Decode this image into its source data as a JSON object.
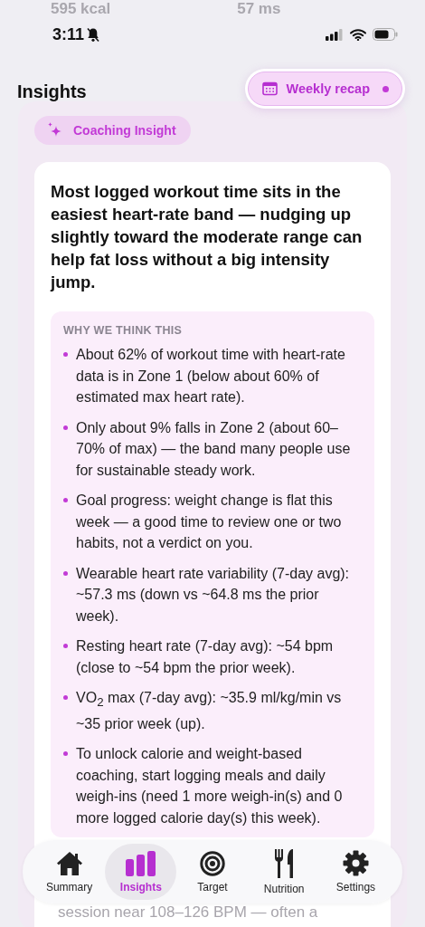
{
  "background_stats": [
    "595 kcal",
    "57 ms"
  ],
  "status_bar": {
    "time": "3:11",
    "silent": true
  },
  "header": {
    "title": "Insights",
    "recap_button": {
      "label": "Weekly recap",
      "unread": true
    }
  },
  "insight": {
    "badge": "Coaching Insight",
    "headline": "Most logged workout time sits in the easiest heart-rate band — nudging up slightly toward the moderate range can help fat loss without a big intensity jump.",
    "reasons_title": "WHY WE THINK THIS",
    "reasons": [
      "About 62% of workout time with heart-rate data is in Zone 1 (below about 60% of estimated max heart rate).",
      "Only about 9% falls in Zone 2 (about 60–70% of max) — the band many people use for sustainable steady work.",
      "Goal progress: weight change is flat this week — a good time to review one or two habits, not a verdict on you.",
      "Wearable heart rate variability (7-day avg): ~57.3 ms (down vs ~64.8 ms the prior week).",
      "Resting heart rate (7-day avg): ~54 bpm (close to ~54 bpm the prior week).",
      "VO$_{2}$ max (7-day avg): ~35.9 ml/kg/min vs ~35 prior week (up).",
      "To unlock calorie and weight-based coaching, start logging meals and daily weigh-ins (need 1 more weigh-in(s) and 0 more logged calorie day(s) this week)."
    ]
  },
  "next_card_lines": [
    "session near 108–126 BPM — often a"
  ],
  "tabs": [
    {
      "label": "Summary",
      "kind": "home",
      "selected": false
    },
    {
      "label": "Insights",
      "kind": "bars",
      "selected": true
    },
    {
      "label": "Target",
      "kind": "target",
      "selected": false
    },
    {
      "label": "Nutrition",
      "kind": "cutlery",
      "selected": false
    },
    {
      "label": "Settings",
      "kind": "gear",
      "selected": false
    }
  ]
}
